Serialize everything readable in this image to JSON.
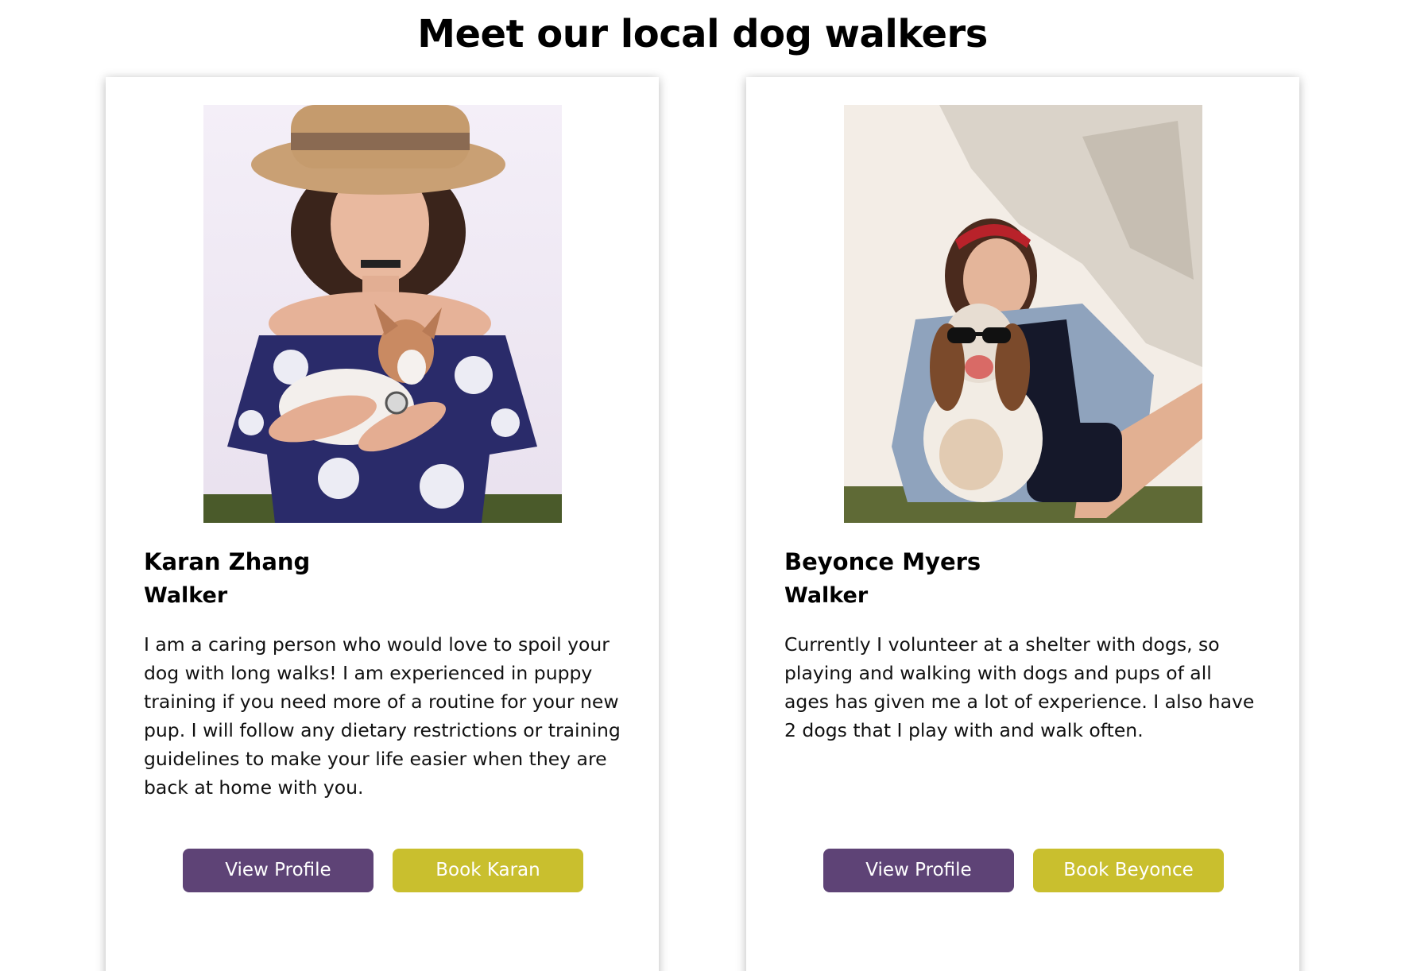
{
  "page": {
    "title": "Meet our local dog walkers"
  },
  "colors": {
    "view_button": "#5e4376",
    "book_button": "#c9bf2e"
  },
  "walkers": [
    {
      "name": "Karan Zhang",
      "role": "Walker",
      "bio": "I am a caring person who would love to spoil your dog with long walks! I am experienced in puppy training if you need more of a routine for your new pup. I will follow any dietary restrictions or training guidelines to make your life easier when they are back at home with you.",
      "view_label": "View Profile",
      "book_label": "Book Karan"
    },
    {
      "name": "Beyonce Myers",
      "role": "Walker",
      "bio": "Currently I volunteer at a shelter with dogs, so playing and walking with dogs and pups of all ages has given me a lot of experience. I also have 2 dogs that I play with and walk often.",
      "view_label": "View Profile",
      "book_label": "Book Beyonce"
    }
  ]
}
